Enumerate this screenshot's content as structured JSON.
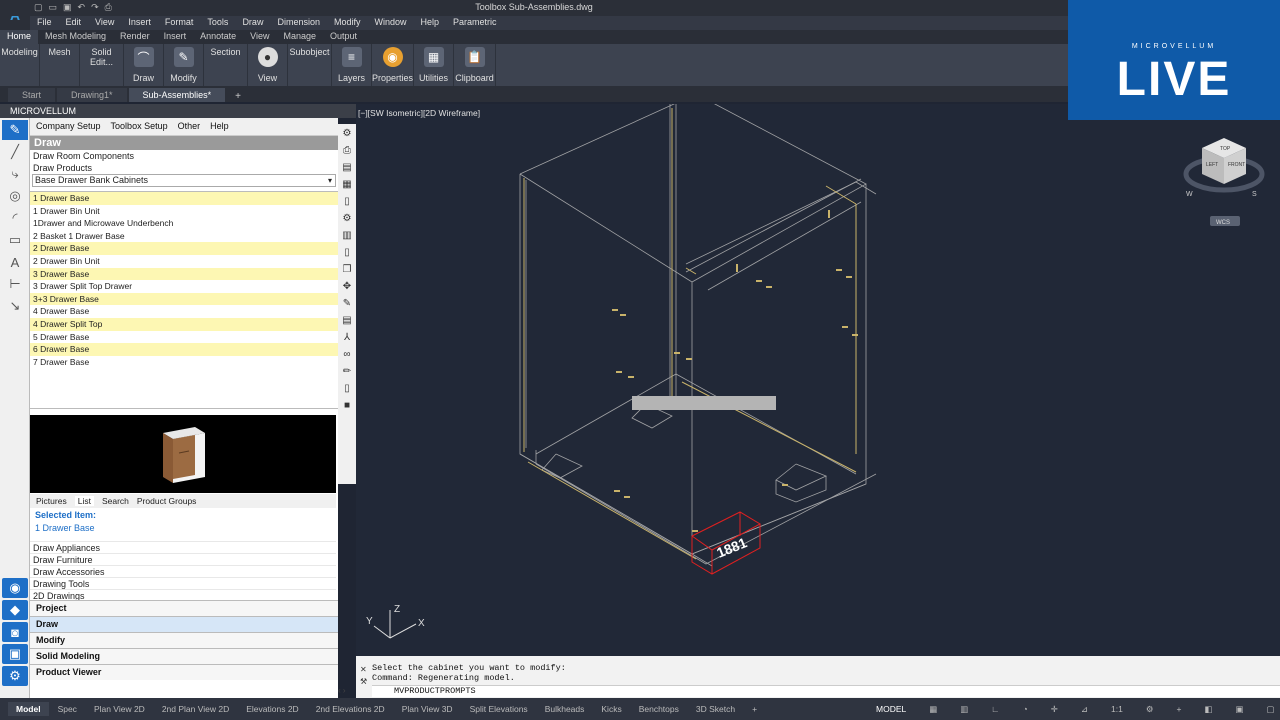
{
  "window": {
    "title": "Toolbox   Sub-Assemblies.dwg",
    "logo": "A"
  },
  "menubar": [
    "File",
    "Edit",
    "View",
    "Insert",
    "Format",
    "Tools",
    "Draw",
    "Dimension",
    "Modify",
    "Window",
    "Help",
    "Parametric"
  ],
  "ribbon_tabs": [
    "Home",
    "Mesh Modeling",
    "Render",
    "Insert",
    "Annotate",
    "View",
    "Manage",
    "Output"
  ],
  "ribbon_buttons": [
    "Modeling",
    "Mesh",
    "Solid Edit...",
    "Draw",
    "Modify",
    "Section",
    "View",
    "Subobject",
    "Layers",
    "Properties",
    "Utilities",
    "Clipboard"
  ],
  "file_tabs": [
    "Start",
    "Drawing1*",
    "Sub-Assemblies*"
  ],
  "palette": {
    "header": "MICROVELLUM",
    "menu": [
      "Company Setup",
      "Toolbox Setup",
      "Other",
      "Help"
    ],
    "draw_title": "Draw",
    "rows": [
      "Draw Room Components",
      "Draw Products"
    ],
    "combo_value": "Base Drawer Bank Cabinets",
    "products": [
      {
        "label": "1 Drawer Base",
        "hl": true
      },
      {
        "label": "1 Drawer Bin Unit",
        "hl": false
      },
      {
        "label": "1Drawer and Microwave Underbench",
        "hl": false
      },
      {
        "label": "2 Basket 1 Drawer Base",
        "hl": false
      },
      {
        "label": "2 Drawer Base",
        "hl": true
      },
      {
        "label": "2 Drawer Bin Unit",
        "hl": false
      },
      {
        "label": "3 Drawer Base",
        "hl": true
      },
      {
        "label": "3 Drawer Split Top Drawer",
        "hl": false
      },
      {
        "label": "3+3 Drawer Base",
        "hl": true
      },
      {
        "label": "4 Drawer Base",
        "hl": false
      },
      {
        "label": "4 Drawer Split Top",
        "hl": true
      },
      {
        "label": "5 Drawer Base",
        "hl": false
      },
      {
        "label": "6 Drawer Base",
        "hl": true
      },
      {
        "label": "7 Drawer Base",
        "hl": false
      }
    ],
    "subtabs": [
      "Pictures",
      "List",
      "Search",
      "Product Groups"
    ],
    "selected_label": "Selected Item:",
    "selected_value": "1 Drawer Base",
    "extras": [
      "Draw Appliances",
      "Draw Furniture",
      "Draw Accessories",
      "Drawing Tools",
      "2D Drawings"
    ],
    "categories": [
      "Project",
      "Draw",
      "Modify",
      "Solid Modeling",
      "Product Viewer"
    ]
  },
  "viewport": {
    "label": "[−][SW Isometric][2D Wireframe]",
    "cube_labels": [
      "TOP",
      "LEFT",
      "FRONT",
      "W",
      "S",
      "WCS"
    ],
    "axis_labels": [
      "Z",
      "Y",
      "X"
    ],
    "tag_text": "1881"
  },
  "overlay": {
    "brand_sub": "MICROVELLUM",
    "brand_big": "LIVE"
  },
  "command": {
    "line1": "Select the cabinet you want to modify:",
    "line2": "Command: Regenerating model.",
    "input": "MVPRODUCTPROMPTS"
  },
  "layout_tabs": [
    "Model",
    "Spec",
    "Plan View 2D",
    "2nd Plan View 2D",
    "Elevations 2D",
    "2nd Elevations 2D",
    "Plan View 3D",
    "Split Elevations",
    "Bulkheads",
    "Kicks",
    "Benchtops",
    "3D Sketch"
  ],
  "status": {
    "model": "MODEL",
    "scale": "1:1"
  }
}
